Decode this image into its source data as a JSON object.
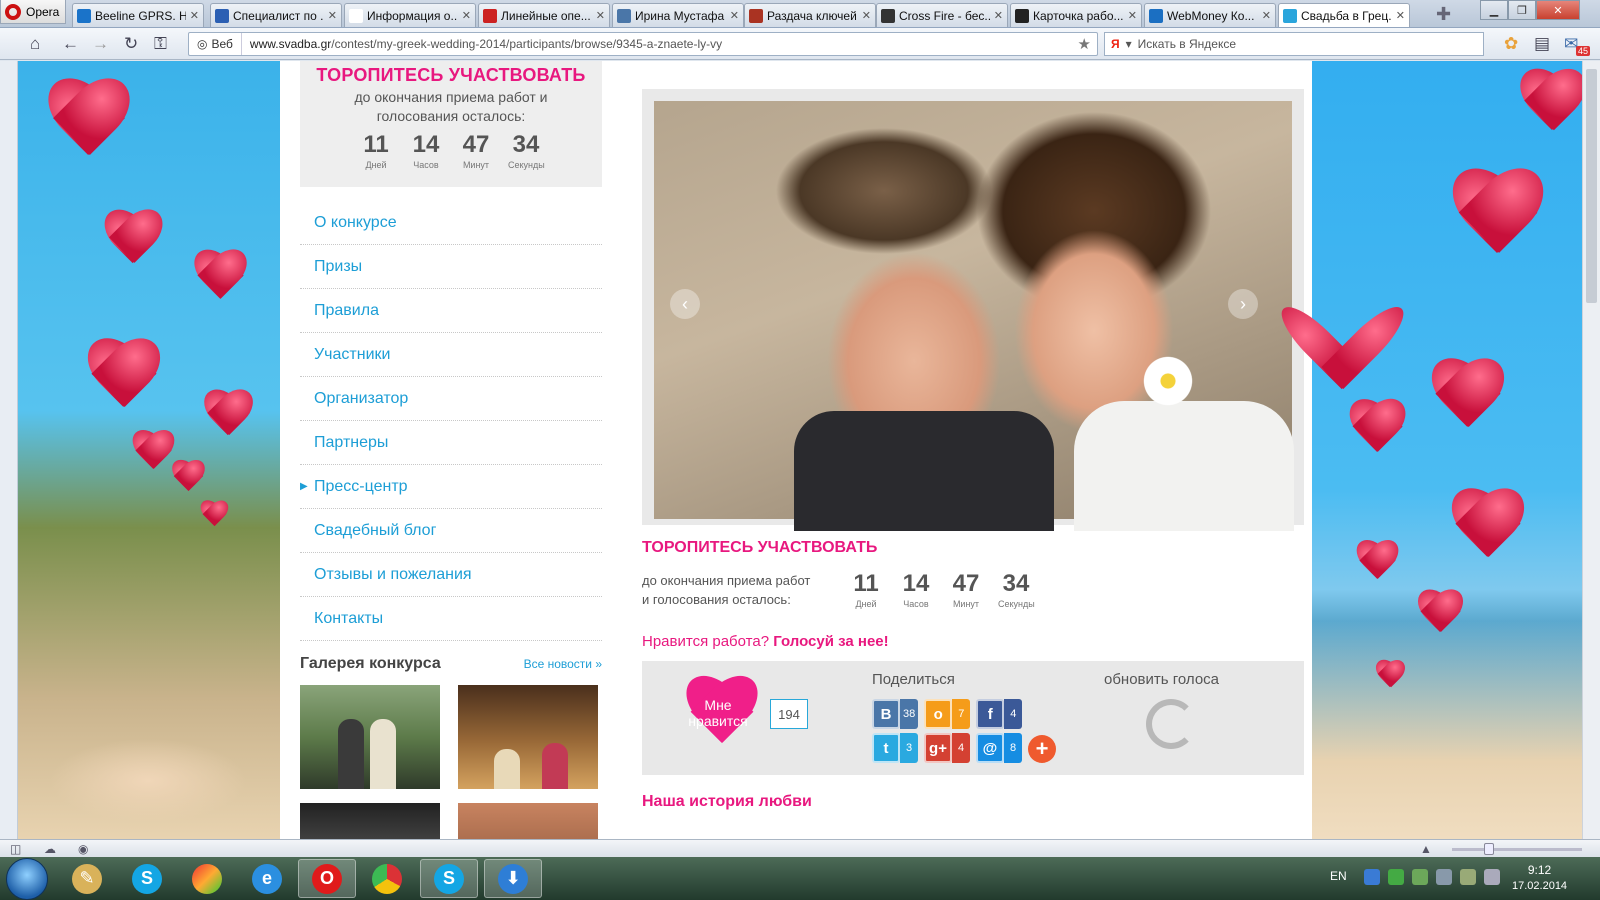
{
  "browser": {
    "menu_label": "Opera",
    "tabs": [
      {
        "title": "Beeline GPRS. H...",
        "color": "#1a73c9"
      },
      {
        "title": "Специалист по ...",
        "color": "#2b5fb3"
      },
      {
        "title": "Информация о...",
        "color": "#ffffff"
      },
      {
        "title": "Линейные опе...",
        "color": "#cc2222"
      },
      {
        "title": "Ирина Мустафа",
        "color": "#4a76a8"
      },
      {
        "title": "Раздача ключей",
        "color": "#aa3322"
      },
      {
        "title": "Cross Fire - бес...",
        "color": "#333333"
      },
      {
        "title": "Карточка рабо...",
        "color": "#222222"
      },
      {
        "title": "WebMoney Ко...",
        "color": "#1b6fc2"
      },
      {
        "title": "Свадьба в Грец...",
        "color": "#2aa5dc"
      }
    ],
    "address": {
      "web_label": "Веб",
      "url_host": "www.svadba.gr",
      "url_path": "/contest/my-greek-wedding-2014/participants/browse/9345-a-znaete-ly-vy"
    },
    "search_placeholder": "Искать в Яндексе",
    "mail_badge": "45"
  },
  "sidebar_counter": {
    "heading": "ТОРОПИТЕСЬ УЧАСТВОВАТЬ",
    "subtitle_line1": "до окончания приема работ и",
    "subtitle_line2": "голосования осталось:",
    "days": "11",
    "days_label": "Дней",
    "hours": "14",
    "hours_label": "Часов",
    "minutes": "47",
    "minutes_label": "Минут",
    "seconds": "34",
    "seconds_label": "Секунды"
  },
  "menu": [
    {
      "label": "О конкурсе"
    },
    {
      "label": "Призы"
    },
    {
      "label": "Правила"
    },
    {
      "label": "Участники"
    },
    {
      "label": "Организатор"
    },
    {
      "label": "Партнеры"
    },
    {
      "label": "Пресс-центр",
      "has_arrow": true
    },
    {
      "label": "Свадебный блог"
    },
    {
      "label": "Отзывы и пожелания"
    },
    {
      "label": "Контакты"
    }
  ],
  "gallery": {
    "title": "Галерея конкурса",
    "more_link": "Все новости »"
  },
  "main": {
    "countdown_heading": "ТОРОПИТЕСЬ УЧАСТВОВАТЬ",
    "countdown_sub_line1": "до окончания приема работ",
    "countdown_sub_line2": "и голосования осталось:",
    "vote_lead": "Нравится работа?",
    "vote_call": "Голосуй за нее!",
    "like_line1": "Мне",
    "like_line2": "нравится",
    "like_count": "194",
    "share_title": "Поделиться",
    "share": [
      {
        "icon": "В",
        "count": "38",
        "color": "#4a76a8"
      },
      {
        "icon": "о",
        "count": "7",
        "color": "#f59c1a"
      },
      {
        "icon": "f",
        "count": "4",
        "color": "#3b5998"
      },
      {
        "icon": "t",
        "count": "3",
        "color": "#2aa9e0"
      },
      {
        "icon": "g+",
        "count": "4",
        "color": "#d44132"
      },
      {
        "icon": "@",
        "count": "8",
        "color": "#168de2"
      }
    ],
    "share_more": "+",
    "refresh_title": "обновить голоса",
    "story_heading": "Наша история любви"
  },
  "taskbar": {
    "lang": "EN",
    "time": "9:12",
    "date": "17.02.2014"
  }
}
